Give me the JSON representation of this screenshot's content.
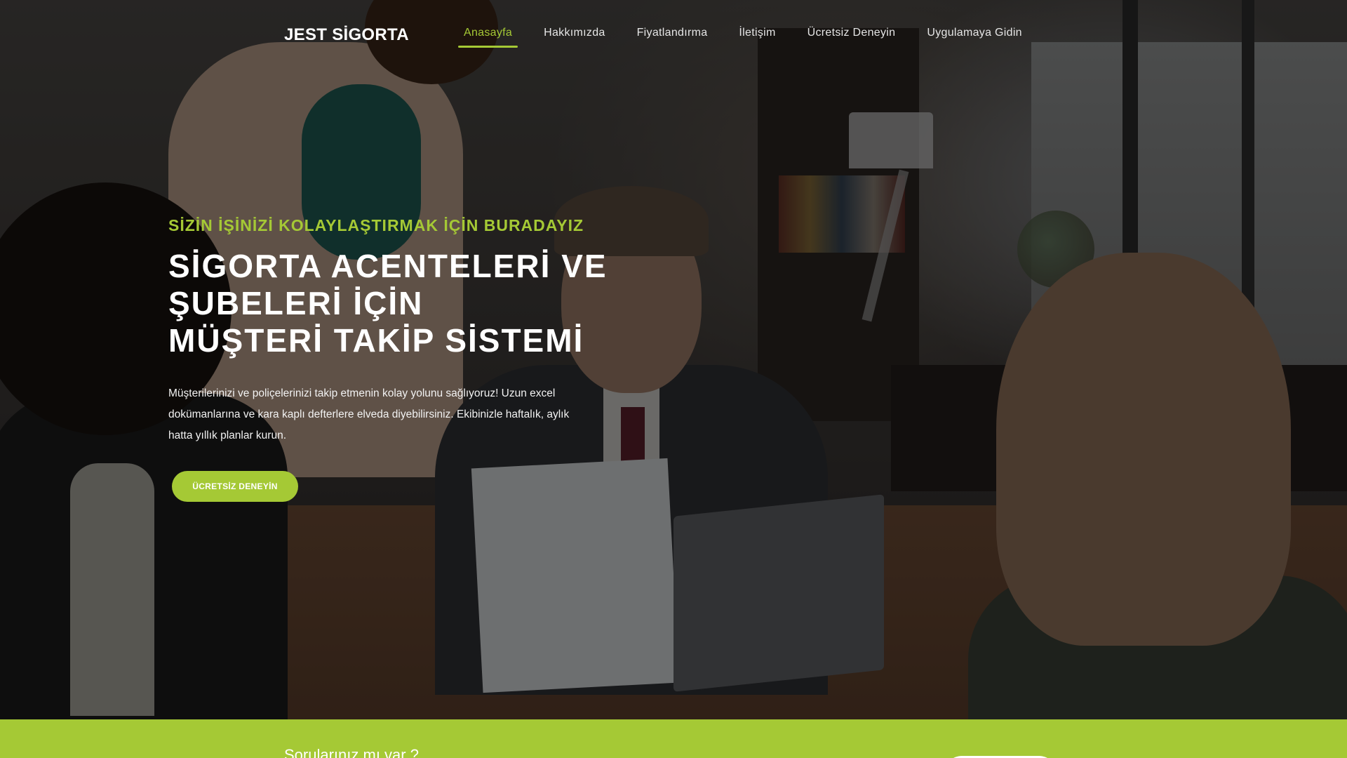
{
  "brand": {
    "logo": "JEST SİGORTA",
    "accent_color": "#a5c935"
  },
  "nav": {
    "items": [
      {
        "label": "Anasayfa",
        "active": true
      },
      {
        "label": "Hakkımızda",
        "active": false
      },
      {
        "label": "Fiyatlandırma",
        "active": false
      },
      {
        "label": "İletişim",
        "active": false
      },
      {
        "label": "Ücretsiz Deneyin",
        "active": false
      },
      {
        "label": "Uygulamaya Gidin",
        "active": false
      }
    ]
  },
  "hero": {
    "eyebrow": "SİZİN İŞİNİZİ KOLAYLAŞTIRMAK İÇİN BURADAYIZ",
    "headline_lines": [
      "SİGORTA ACENTELERİ VE",
      "ŞUBELERİ İÇİN",
      "MÜŞTERİ TAKİP SİSTEMİ"
    ],
    "description": "Müşterilerinizi ve poliçelerinizi takip etmenin kolay yolunu sağlıyoruz! Uzun excel dokümanlarına ve kara kaplı defterlere elveda diyebilirsiniz. Ekibinizle haftalık, aylık hatta yıllık planlar kurun.",
    "cta_label": "ÜCRETSİZ DENEYİN"
  },
  "footer_strip": {
    "text": "Sorularınız mı var ?"
  }
}
